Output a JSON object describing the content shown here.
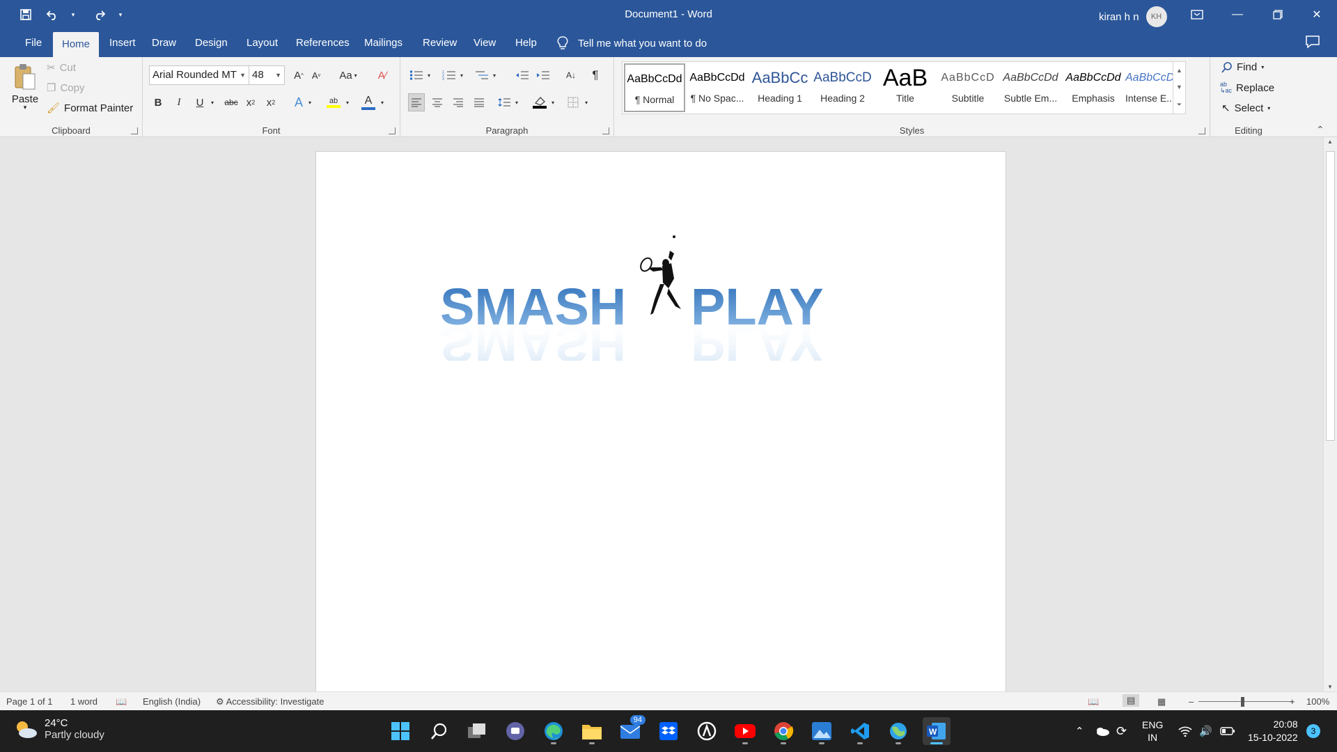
{
  "window": {
    "doc_title": "Document1  -  Word",
    "user_name": "kiran h n",
    "user_initials": "KH"
  },
  "tabs": [
    "File",
    "Home",
    "Insert",
    "Draw",
    "Design",
    "Layout",
    "References",
    "Mailings",
    "Review",
    "View",
    "Help"
  ],
  "tell_me": "Tell me what you want to do",
  "clipboard": {
    "paste": "Paste",
    "cut": "Cut",
    "copy": "Copy",
    "format_painter": "Format Painter",
    "label": "Clipboard"
  },
  "font": {
    "family": "Arial Rounded MT",
    "size": "48",
    "change_case": "Aa",
    "label": "Font"
  },
  "paragraph": {
    "label": "Paragraph"
  },
  "styles": {
    "label": "Styles",
    "items": [
      {
        "preview": "AaBbCcDd",
        "name": "¶ Normal"
      },
      {
        "preview": "AaBbCcDd",
        "name": "¶ No Spac..."
      },
      {
        "preview": "AaBbCc",
        "name": "Heading 1"
      },
      {
        "preview": "AaBbCcD",
        "name": "Heading 2"
      },
      {
        "preview": "AaB",
        "name": "Title"
      },
      {
        "preview": "AaBbCcD",
        "name": "Subtitle"
      },
      {
        "preview": "AaBbCcDd",
        "name": "Subtle Em..."
      },
      {
        "preview": "AaBbCcDd",
        "name": "Emphasis"
      },
      {
        "preview": "AaBbCcDd",
        "name": "Intense E..."
      }
    ]
  },
  "editing": {
    "find": "Find",
    "replace": "Replace",
    "select": "Select",
    "label": "Editing"
  },
  "document": {
    "logo_left": "SMASH",
    "logo_right": "PLAY"
  },
  "status": {
    "page": "Page 1 of 1",
    "words": "1 word",
    "language": "English (India)",
    "accessibility": "Accessibility: Investigate",
    "zoom": "100%"
  },
  "taskbar": {
    "temp": "24°C",
    "weather": "Partly cloudy",
    "mail_badge": "94",
    "lang1": "ENG",
    "lang2": "IN",
    "time": "20:08",
    "date": "15-10-2022",
    "notif_count": "3"
  },
  "colors": {
    "word_blue": "#2b579a",
    "logo_blue": "#4b8fd6",
    "taskbar": "#1f1f1f"
  }
}
